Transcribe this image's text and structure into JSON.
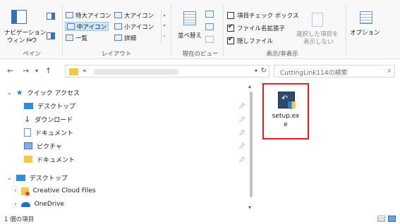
{
  "ribbon": {
    "panes": {
      "nav_pane_label_1": "ナビゲーション",
      "nav_pane_label_2": "ウィンドウ",
      "group_label": "ペイン"
    },
    "layout": {
      "extra_large": "特大アイコン",
      "large": "大アイコン",
      "medium": "中アイコン",
      "small": "小アイコン",
      "list": "一覧",
      "details": "詳細",
      "group_label": "レイアウト"
    },
    "current_view": {
      "sort_label": "並べ替え",
      "group_label": "現在のビュー"
    },
    "show_hide": {
      "item_checkbox": "項目チェック ボックス",
      "extensions": "ファイル名拡張子",
      "hidden": "隠しファイル",
      "hide_selected_1": "選択した項目を",
      "hide_selected_2": "表示しない",
      "group_label": "表示/非表示"
    },
    "options": {
      "label": "オプション"
    }
  },
  "address": {
    "path_prefix": "«",
    "search_placeholder": "CuttingLink114の検索"
  },
  "sidebar": {
    "quick_access": "クイック アクセス",
    "items": [
      {
        "label": "デスクトップ"
      },
      {
        "label": "ダウンロード"
      },
      {
        "label": "ドキュメント"
      },
      {
        "label": "ピクチャ"
      },
      {
        "label": "ドキュメント"
      }
    ],
    "desktop": "デスクトップ",
    "creative_cloud": "Creative Cloud Files",
    "onedrive": "OneDrive"
  },
  "content": {
    "file_name_line1": "setup.ex",
    "file_name_line2": "e"
  },
  "status": {
    "item_count": "1 個の項目"
  },
  "colors": {
    "highlight_red": "#e11d1d",
    "selection_blue": "#cce4f7",
    "folder_yellow": "#f7c74a",
    "star_blue": "#2f7bd6"
  }
}
